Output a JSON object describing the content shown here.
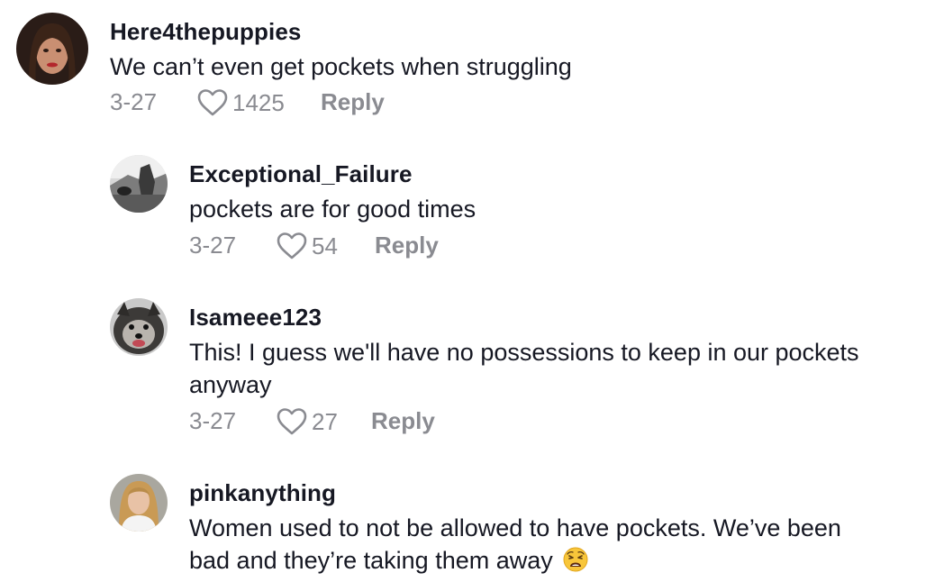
{
  "comments": [
    {
      "username": "Here4thepuppies",
      "text_lines": [
        "We can’t even get pockets when struggling"
      ],
      "date": "3-27",
      "likes": "1425",
      "reply_label": "Reply",
      "avatar_icon": "profile-photo-woman-dark-hair"
    },
    {
      "username": "Exceptional_Failure",
      "text_lines": [
        "pockets are for good times"
      ],
      "date": "3-27",
      "likes": "54",
      "reply_label": "Reply",
      "avatar_icon": "profile-photo-grayscale-scene"
    },
    {
      "username": "Isameee123",
      "text_lines": [
        "This! I guess we'll have no possessions to keep in our pockets",
        "anyway"
      ],
      "date": "3-27",
      "likes": "27",
      "reply_label": "Reply",
      "avatar_icon": "profile-photo-fluffy-dog"
    },
    {
      "username": "pinkanything",
      "text_lines": [
        "Women used to not be allowed to have pockets. We’ve been",
        "bad and they’re taking them away"
      ],
      "date": "",
      "likes": "",
      "reply_label": "",
      "avatar_icon": "profile-photo-blonde-woman",
      "trailing_emoji": "weary-face-emoji"
    }
  ],
  "colors": {
    "text": "#161823",
    "meta": "#8a8b91",
    "background": "#ffffff"
  }
}
